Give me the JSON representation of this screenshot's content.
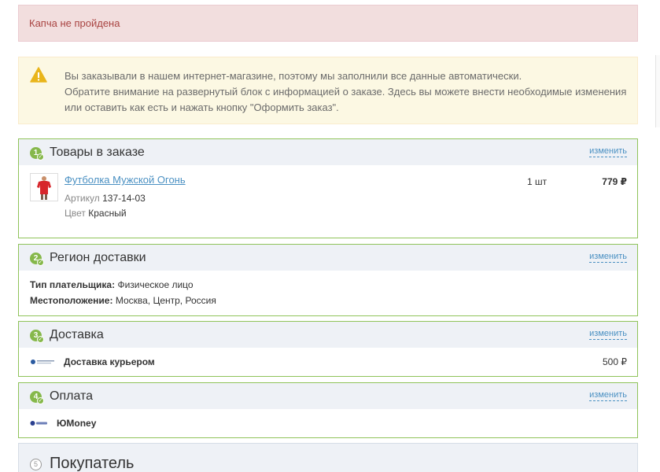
{
  "alerts": {
    "error": "Капча не пройдена",
    "info_line1": "Вы заказывали в нашем интернет-магазине, поэтому мы заполнили все данные автоматически.",
    "info_line2": "Обратите внимание на развернутый блок с информацией о заказе. Здесь вы можете внести необходимые изменения",
    "info_line3": "или оставить как есть и нажать кнопку \"Оформить заказ\"."
  },
  "edit_label": "изменить",
  "blocks": {
    "basket": {
      "num": "1",
      "title": "Товары в заказе",
      "item": {
        "name": "Футболка Мужской Огонь",
        "article_label": "Артикул",
        "article_value": "137-14-03",
        "color_label": "Цвет",
        "color_value": "Красный",
        "qty": "1 шт",
        "price": "779 ₽"
      }
    },
    "region": {
      "num": "2",
      "title": "Регион доставки",
      "payer_label": "Тип плательщика:",
      "payer_value": "Физическое лицо",
      "location_label": "Местоположение:",
      "location_value": "Москва, Центр, Россия"
    },
    "delivery": {
      "num": "3",
      "title": "Доставка",
      "method": "Доставка курьером",
      "price": "500 ₽"
    },
    "payment": {
      "num": "4",
      "title": "Оплата",
      "method": "ЮMoney"
    },
    "buyer": {
      "num": "5",
      "title": "Покупатель"
    }
  },
  "colors": {
    "block_border": "#8fc35a",
    "head_bg": "#eef1f6",
    "link": "#4a90c2",
    "danger_bg": "#f2dede",
    "warning_bg": "#fcf8e3"
  }
}
